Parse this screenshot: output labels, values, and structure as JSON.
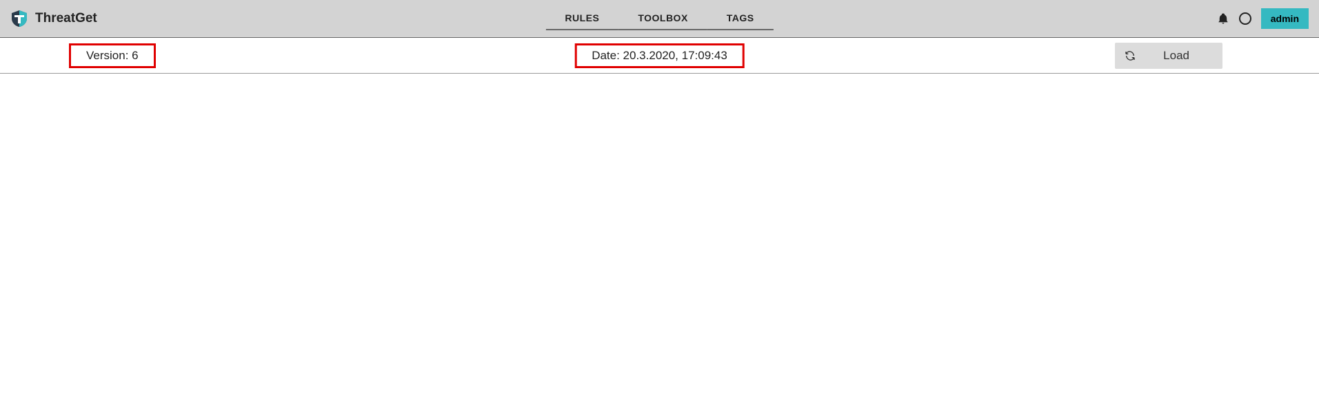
{
  "header": {
    "app_name": "ThreatGet",
    "tabs": [
      {
        "label": "RULES"
      },
      {
        "label": "TOOLBOX"
      },
      {
        "label": "TAGS"
      }
    ],
    "user_label": "admin"
  },
  "info_bar": {
    "version_text": "Version: 6",
    "date_text": "Date: 20.3.2020, 17:09:43",
    "load_button_label": "Load"
  }
}
